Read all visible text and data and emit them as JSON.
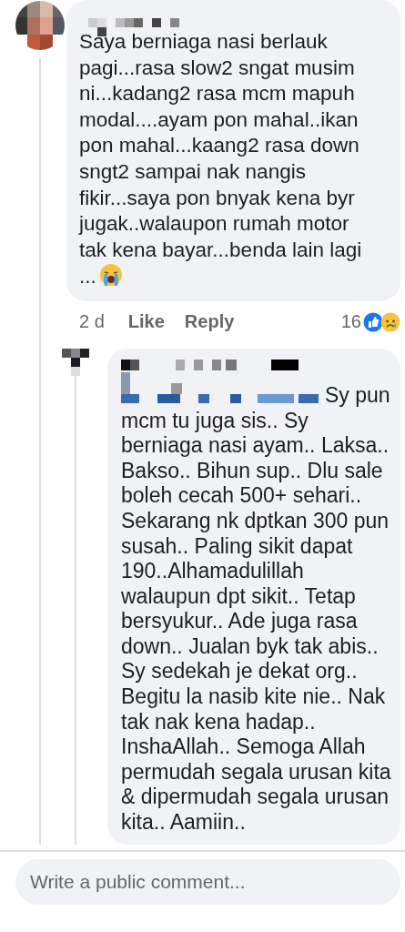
{
  "comment": {
    "text": "Saya berniaga nasi berlauk pagi...rasa slow2 sngat musim ni...kadang2 rasa mcm mapuh modal....ayam pon mahal..ikan pon mahal...kaang2 rasa down sngt2 sampai nak nangis fikir...saya pon bnyak kena byr jugak..walaupon rumah motor tak kena bayar...benda lain lagi ...",
    "time": "2 d",
    "like": "Like",
    "reply": "Reply",
    "reaction_count": "16"
  },
  "reply": {
    "text": "Sy pun mcm tu juga sis.. Sy berniaga nasi ayam.. Laksa.. Bakso.. Bihun sup.. Dlu sale boleh cecah 500+ sehari.. Sekarang nk dptkan 300 pun susah.. Paling sikit dapat 190..Alhamadulillah walaupun dpt sikit.. Tetap bersyukur.. Ade juga rasa down.. Jualan byk tak abis.. Sy sedekah je dekat org.. Begitu la nasib kite nie.. Nak tak nak kena hadap.. InshaAllah.. Semoga Allah permudah segala urusan kita & dipermudah segala urusan kita.. Aamiin.."
  },
  "composer": {
    "placeholder": "Write a public comment..."
  }
}
